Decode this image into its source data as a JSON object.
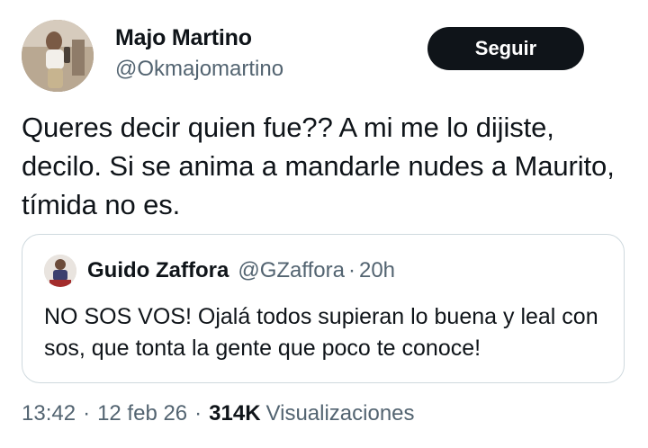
{
  "author": {
    "name": "Majo Martino",
    "handle": "@Okmajomartino"
  },
  "follow_button": {
    "label": "Seguir"
  },
  "tweet": {
    "text": "Queres decir quien fue?? A mi me lo dijiste, decilo. Si se anima a mandarle nudes a Maurito, tímida no es."
  },
  "quoted_tweet": {
    "name": "Guido Zaffora",
    "handle": "@GZaffora",
    "separator": "·",
    "time": "20h",
    "text": "NO SOS VOS! Ojalá todos supieran lo buena y leal con sos, que tonta la gente que poco te conoce!"
  },
  "meta": {
    "time": "13:42",
    "separator": "·",
    "date": "12 feb 26",
    "views_count": "314K",
    "views_label": "Visualizaciones"
  },
  "colors": {
    "text_primary": "#0f1419",
    "text_secondary": "#536471",
    "button_bg": "#0f1419",
    "border": "#cfd9de"
  }
}
